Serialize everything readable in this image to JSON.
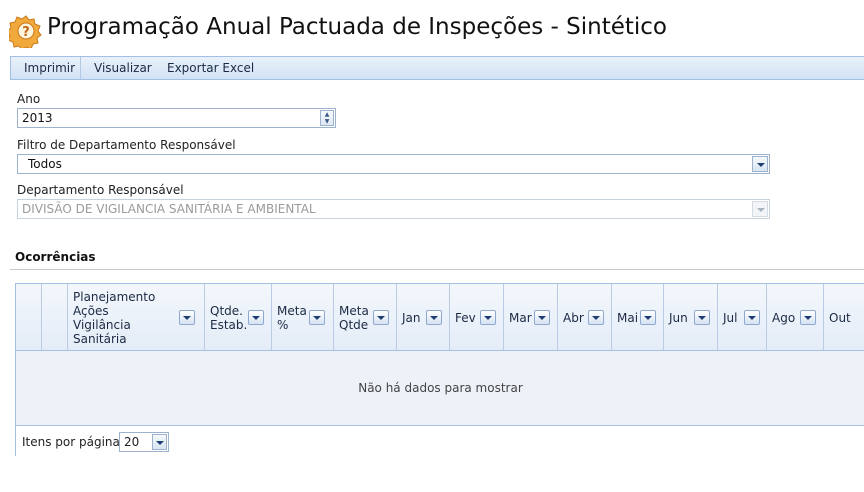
{
  "header": {
    "title": "Programação Anual Pactuada de Inspeções - Sintético",
    "icon": "gear-question-icon"
  },
  "toolbar": {
    "items": [
      "Imprimir",
      "Visualizar",
      "Exportar Excel"
    ]
  },
  "form": {
    "ano": {
      "label": "Ano",
      "value": "2013"
    },
    "filtro": {
      "label": "Filtro de Departamento Responsável",
      "value": "Todos"
    },
    "departamento": {
      "label": "Departamento Responsável",
      "value": "DIVISÃO DE VIGILANCIA SANITÁRIA E AMBIENTAL"
    }
  },
  "section": {
    "title": "Ocorrências"
  },
  "grid": {
    "columns": [
      "",
      "",
      "Planejamento\nAções\nVigilância\nSanitária",
      "Qtde.\nEstab.",
      "Meta\n%",
      "Meta\nQtde",
      "Jan",
      "Fev",
      "Mar",
      "Abr",
      "Mai",
      "Jun",
      "Jul",
      "Ago",
      "Out"
    ],
    "empty_message": "Não há dados para mostrar",
    "pager": {
      "label": "Itens por página:",
      "value": "20"
    }
  },
  "colors": {
    "accent": "#a3bfe2",
    "toolbar_bg": "#dce8f7",
    "grid_bg": "#edf2f9"
  }
}
